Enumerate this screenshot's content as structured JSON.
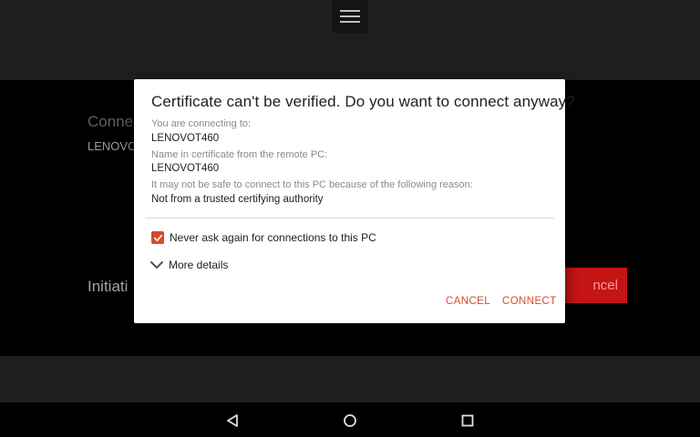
{
  "background": {
    "label_partial": "Conne",
    "host_partial": "LENOVO",
    "status_partial": "Initiati",
    "cancel_partial": "ncel"
  },
  "dialog": {
    "title": "Certificate can't be verified. Do you want to connect anyway?",
    "connecting_to_label": "You are connecting to:",
    "connecting_to_value": "LENOVOT460",
    "cert_name_label": "Name in certificate from the remote PC:",
    "cert_name_value": "LENOVOT460",
    "reason_label": "It may not be safe to connect to this PC because of the following reason:",
    "reason_value": "Not from a trusted certifying authority",
    "checkbox_label": "Never ask again for connections to this PC",
    "checkbox_checked": true,
    "more_details_label": "More details",
    "cancel_label": "CANCEL",
    "connect_label": "CONNECT"
  },
  "colors": {
    "accent": "#d84a2b",
    "background_cancel": "#c41414"
  },
  "icons": {
    "menu": "hamburger-icon",
    "expand": "chevron-down-icon",
    "check": "check-icon",
    "back": "back-triangle-icon",
    "home": "home-circle-icon",
    "recent": "recent-square-icon"
  }
}
